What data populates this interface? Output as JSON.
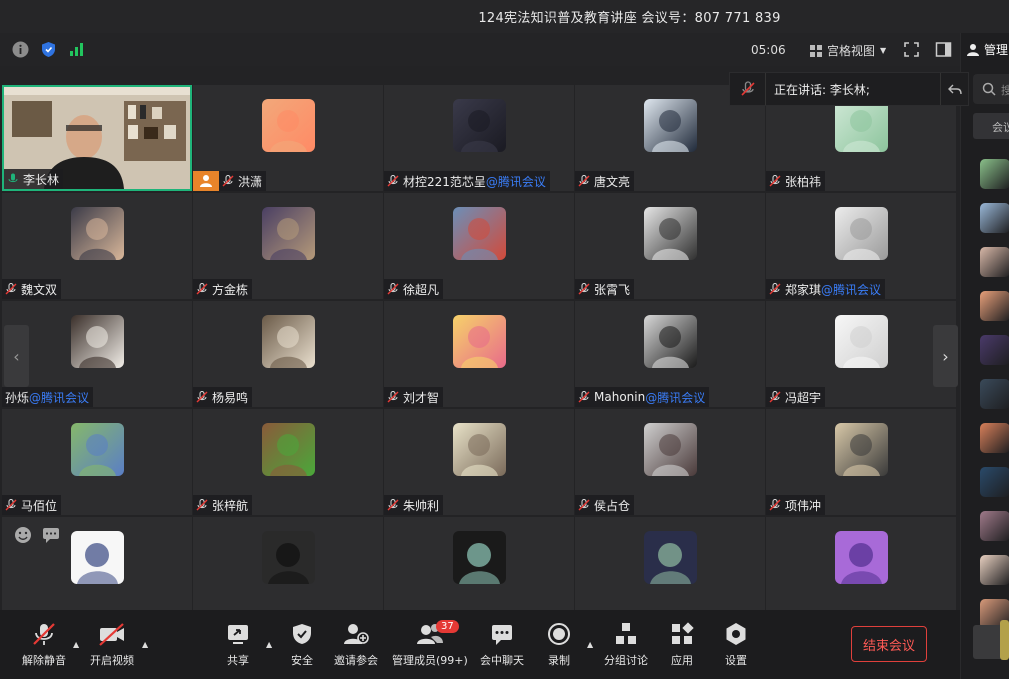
{
  "window": {
    "title": "124宪法知识普及教育讲座 会议号：807 771 839"
  },
  "infobar": {
    "timer": "05:06",
    "view_label": "宫格视图",
    "icons": [
      "info-icon",
      "shield-icon",
      "signal-icon",
      "fullscreen-icon",
      "sidebar-toggle-icon"
    ]
  },
  "speaking": {
    "text": "正在讲话: 李长林;"
  },
  "participants": [
    {
      "name": "李长林",
      "suffix": "",
      "mic": "on",
      "host": false,
      "video": true
    },
    {
      "name": "洪潇",
      "suffix": "",
      "mic": "muted",
      "host": true
    },
    {
      "name": "材控221范芯呈",
      "suffix": "@腾讯会议",
      "mic": "muted"
    },
    {
      "name": "唐文亮",
      "suffix": "",
      "mic": "muted"
    },
    {
      "name": "张柏祎",
      "suffix": "",
      "mic": "muted"
    },
    {
      "name": "魏文双",
      "suffix": "",
      "mic": "muted"
    },
    {
      "name": "方金栋",
      "suffix": "",
      "mic": "muted"
    },
    {
      "name": "徐超凡",
      "suffix": "",
      "mic": "muted"
    },
    {
      "name": "张霄飞",
      "suffix": "",
      "mic": "muted"
    },
    {
      "name": "郑家琪",
      "suffix": "@腾讯会议",
      "mic": "muted"
    },
    {
      "name": "孙烁",
      "suffix": "@腾讯会议",
      "mic": "none"
    },
    {
      "name": "杨易鸣",
      "suffix": "",
      "mic": "muted"
    },
    {
      "name": "刘才智",
      "suffix": "",
      "mic": "muted"
    },
    {
      "name": "Mahonin",
      "suffix": "@腾讯会议",
      "mic": "muted"
    },
    {
      "name": "冯超宇",
      "suffix": "",
      "mic": "muted"
    },
    {
      "name": "马佰位",
      "suffix": "",
      "mic": "muted"
    },
    {
      "name": "张梓航",
      "suffix": "",
      "mic": "muted"
    },
    {
      "name": "朱帅利",
      "suffix": "",
      "mic": "muted"
    },
    {
      "name": "侯占仓",
      "suffix": "",
      "mic": "muted"
    },
    {
      "name": "项伟冲",
      "suffix": "",
      "mic": "muted"
    },
    {
      "name": "",
      "suffix": "",
      "mic": "none"
    },
    {
      "name": "",
      "suffix": "",
      "mic": "none"
    },
    {
      "name": "",
      "suffix": "",
      "mic": "none"
    },
    {
      "name": "",
      "suffix": "",
      "mic": "none"
    },
    {
      "name": "",
      "suffix": "",
      "mic": "none"
    }
  ],
  "toolbar": {
    "unmute": "解除静音",
    "video": "开启视频",
    "share": "共享",
    "security": "安全",
    "invite": "邀请参会",
    "members": "管理成员(99+)",
    "members_badge": "37",
    "chat": "会中聊天",
    "record": "录制",
    "breakout": "分组讨论",
    "apps": "应用",
    "settings": "设置",
    "end": "结束会议"
  },
  "panel": {
    "title": "管理",
    "search_placeholder": "搜",
    "tab": "会议"
  },
  "colors": {
    "accent_green": "#1fb47a",
    "mute_red": "#e53935",
    "link_blue": "#3a7cf5",
    "host_orange": "#e8842a",
    "end_red": "#e0403c"
  }
}
